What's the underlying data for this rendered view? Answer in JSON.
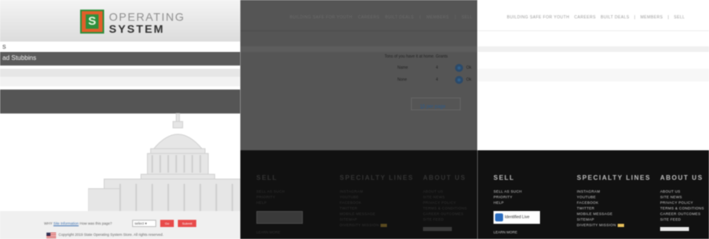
{
  "panel1": {
    "logo": {
      "line1": "OPERATING",
      "line2": "SYSTEM",
      "mark": "S"
    },
    "breadcrumb": "s",
    "nav_bar_label": "ad Stubbins",
    "feedback": {
      "prefix": "WHY ",
      "link": "Site Information",
      "question": " How was this page?",
      "select_value": "select",
      "btn1": "Go",
      "btn2": "Submit"
    },
    "copyright": "Copyright 2019 State Operating System Store. All rights reserved."
  },
  "panel2": {
    "top_nav": [
      "BUILDING SAFE FOR YOUTH",
      "CAREERS",
      "BUILT DEALS",
      "|",
      "MEMBERS",
      "|",
      "SELL"
    ],
    "help_question": "Tons of you have it at home. Grants",
    "rows": [
      {
        "label": "Name",
        "value": "4",
        "tail": "Ok"
      },
      {
        "label": "None",
        "value": "4",
        "tail": "Ok"
      }
    ],
    "per_page": "15 per page",
    "footer": {
      "columns": [
        {
          "title": "SELL",
          "links": [
            "SELL AS SUCH",
            "PRIORITY",
            "HELP"
          ]
        },
        {
          "title": "SPECIALTY LINES",
          "links": [
            "INSTAGRAM",
            "YOUTUBE",
            "FACEBOOK",
            "TWITTER",
            "MOBILE MESSAGE",
            "SITEMAP",
            "DIVERSITY MISSION"
          ]
        },
        {
          "title": "ABOUT US",
          "links": [
            "ABOUT US",
            "SITE NEWS",
            "PRIVACY POLICY",
            "TERMS & CONDITIONS",
            "CAREER OUTCOMES",
            "SITE FEED"
          ]
        }
      ],
      "bottom_link": "LEARN MORE"
    }
  },
  "panel3": {
    "top_nav": [
      "BUILDING SAFE FOR YOUTH",
      "CAREERS",
      "BUILT DEALS",
      "|",
      "MEMBERS",
      "|",
      "SELL"
    ],
    "footer": {
      "columns": [
        {
          "title": "SELL",
          "links": [
            "SELL AS SUCH",
            "PRIORITY",
            "HELP"
          ]
        },
        {
          "title": "SPECIALTY LINES",
          "links": [
            "INSTAGRAM",
            "YOUTUBE",
            "FACEBOOK",
            "TWITTER",
            "MOBILE MESSAGE",
            "SITEMAP",
            "DIVERSITY MISSION"
          ]
        },
        {
          "title": "ABOUT US",
          "links": [
            "ABOUT US",
            "SITE NEWS",
            "PRIVACY POLICY",
            "TERMS & CONDITIONS",
            "CAREER OUTCOMES",
            "SITE FEED"
          ]
        }
      ],
      "verified_label": "Identified Live",
      "bottom_link": "LEARN MORE"
    }
  },
  "colors": {
    "logo_orange": "#e25f2a",
    "logo_green": "#2f8f3c",
    "nav_gray": "#5a5a5a",
    "overlay_gray": "#555555",
    "footer_black": "#111111",
    "accent_red": "#e84b4b",
    "link_blue": "#2c5a8a"
  },
  "icons": {
    "capitol": "capitol-dome-icon",
    "flag": "us-flag-icon",
    "help_row": "circle-info-icon",
    "verified": "verified-check-icon",
    "dropdown": "chevron-down-icon"
  }
}
